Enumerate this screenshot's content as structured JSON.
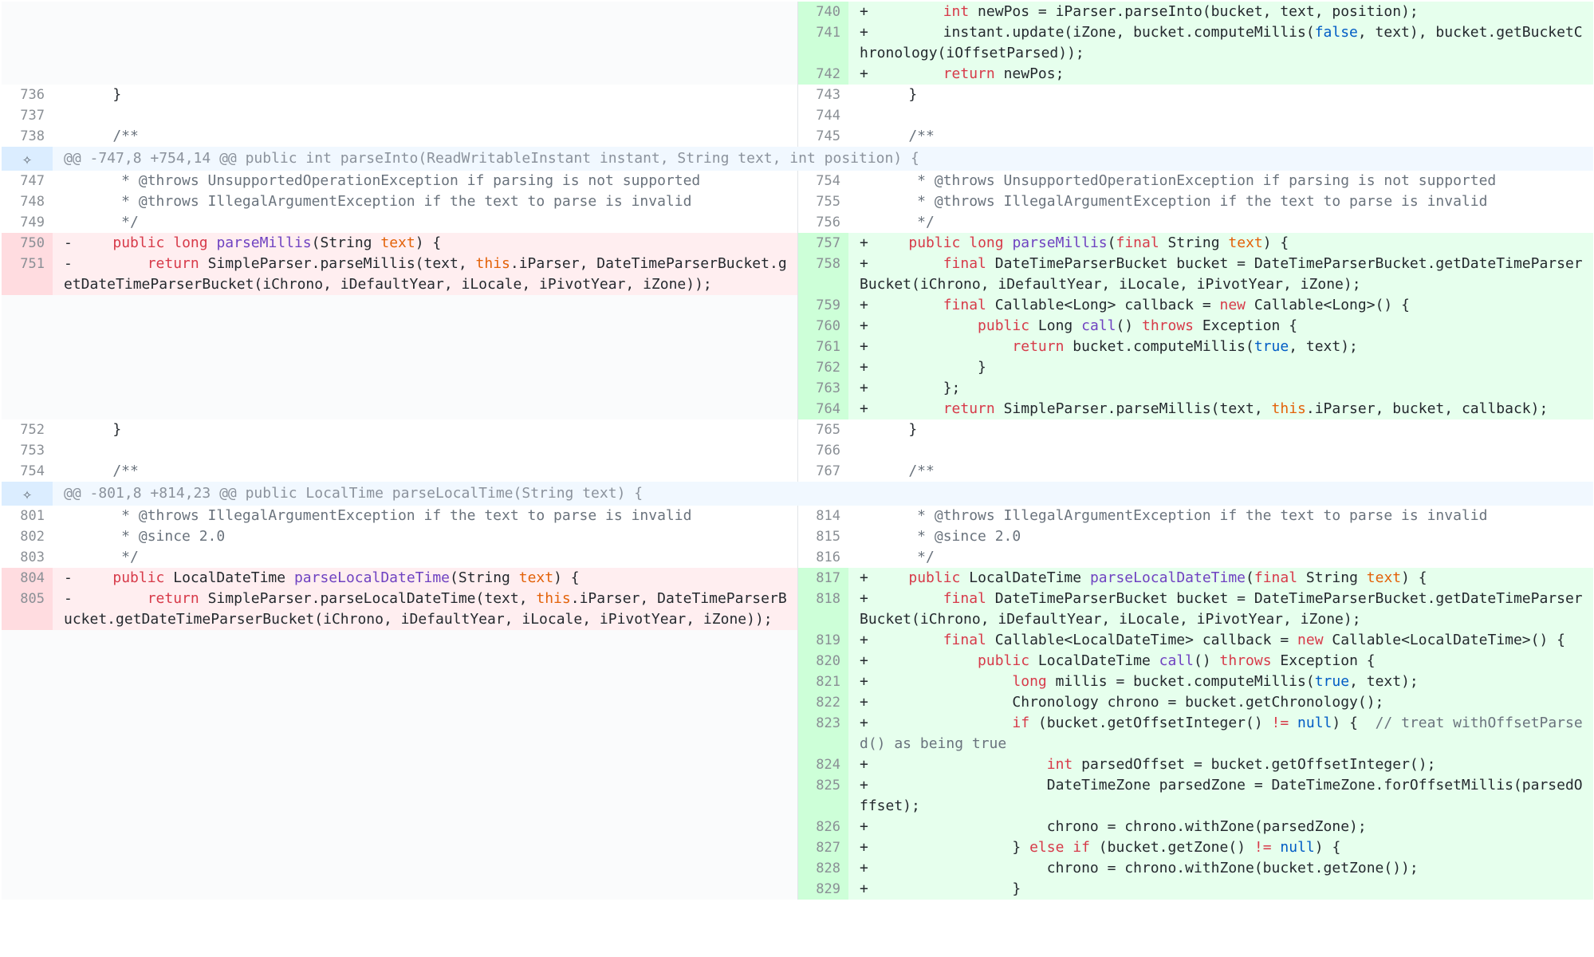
{
  "hunk_headers": [
    "@@ -747,8 +754,14 @@ public int parseInto(ReadWritableInstant instant, String text, int position) {",
    "@@ -801,8 +814,23 @@ public LocalTime parseLocalTime(String text) {"
  ],
  "expand_icon": "unfold-icon",
  "colors": {
    "deleted_line_bg": "#ffeef0",
    "added_line_bg": "#e6ffed",
    "deleted_gutter_bg": "#ffdce0",
    "added_gutter_bg": "#cdffd8",
    "hunk_bg": "#f1f8ff",
    "keyword": "#d73a49",
    "string_param": "#e36209",
    "method": "#6f42c1",
    "literal": "#005cc5",
    "comment": "#6a737d"
  },
  "rows": [
    {
      "type": "line",
      "l_num": "",
      "l_tok": [],
      "l_kind": "blank",
      "r_num": "740",
      "r_tok": [
        [
          "p",
          "+"
        ],
        [
          "t",
          "        "
        ],
        [
          "k",
          "int"
        ],
        [
          "t",
          " newPos = iParser.parseInto(bucket, text, position);"
        ]
      ],
      "r_kind": "add"
    },
    {
      "type": "line",
      "l_num": "",
      "l_tok": [],
      "l_kind": "blank",
      "r_num": "741",
      "r_tok": [
        [
          "p",
          "+"
        ],
        [
          "t",
          "        instant.update(iZone, bucket.computeMillis("
        ],
        [
          "b",
          "false"
        ],
        [
          "t",
          ", text), bucket.getBucketChronology(iOffsetParsed));"
        ]
      ],
      "r_kind": "add"
    },
    {
      "type": "line",
      "l_num": "",
      "l_tok": [],
      "l_kind": "blank",
      "r_num": "742",
      "r_tok": [
        [
          "p",
          "+"
        ],
        [
          "t",
          "        "
        ],
        [
          "k",
          "return"
        ],
        [
          "t",
          " newPos;"
        ]
      ],
      "r_kind": "add"
    },
    {
      "type": "line",
      "l_num": "736",
      "l_tok": [
        [
          "p",
          " "
        ],
        [
          "t",
          "    }"
        ]
      ],
      "l_kind": "ctx",
      "r_num": "743",
      "r_tok": [
        [
          "p",
          " "
        ],
        [
          "t",
          "    }"
        ]
      ],
      "r_kind": "ctx"
    },
    {
      "type": "line",
      "l_num": "737",
      "l_tok": [],
      "l_kind": "ctx",
      "r_num": "744",
      "r_tok": [],
      "r_kind": "ctx"
    },
    {
      "type": "line",
      "l_num": "738",
      "l_tok": [
        [
          "p",
          " "
        ],
        [
          "c",
          "    /**"
        ]
      ],
      "l_kind": "ctx",
      "r_num": "745",
      "r_tok": [
        [
          "p",
          " "
        ],
        [
          "c",
          "    /**"
        ]
      ],
      "r_kind": "ctx"
    },
    {
      "type": "hunk",
      "idx": 0
    },
    {
      "type": "line",
      "l_num": "747",
      "l_tok": [
        [
          "p",
          " "
        ],
        [
          "c",
          "     * @throws UnsupportedOperationException if parsing is not supported"
        ]
      ],
      "l_kind": "ctx",
      "r_num": "754",
      "r_tok": [
        [
          "p",
          " "
        ],
        [
          "c",
          "     * @throws UnsupportedOperationException if parsing is not supported"
        ]
      ],
      "r_kind": "ctx"
    },
    {
      "type": "line",
      "l_num": "748",
      "l_tok": [
        [
          "p",
          " "
        ],
        [
          "c",
          "     * @throws IllegalArgumentException if the text to parse is invalid"
        ]
      ],
      "l_kind": "ctx",
      "r_num": "755",
      "r_tok": [
        [
          "p",
          " "
        ],
        [
          "c",
          "     * @throws IllegalArgumentException if the text to parse is invalid"
        ]
      ],
      "r_kind": "ctx"
    },
    {
      "type": "line",
      "l_num": "749",
      "l_tok": [
        [
          "p",
          " "
        ],
        [
          "c",
          "     */"
        ]
      ],
      "l_kind": "ctx",
      "r_num": "756",
      "r_tok": [
        [
          "p",
          " "
        ],
        [
          "c",
          "     */"
        ]
      ],
      "r_kind": "ctx"
    },
    {
      "type": "line",
      "l_num": "750",
      "l_tok": [
        [
          "p",
          "-"
        ],
        [
          "t",
          "    "
        ],
        [
          "k",
          "public"
        ],
        [
          "t",
          " "
        ],
        [
          "k",
          "long"
        ],
        [
          "t",
          " "
        ],
        [
          "f",
          "parseMillis"
        ],
        [
          "t",
          "(String "
        ],
        [
          "s",
          "text"
        ],
        [
          "t",
          ") {"
        ]
      ],
      "l_kind": "del",
      "r_num": "757",
      "r_tok": [
        [
          "p",
          "+"
        ],
        [
          "t",
          "    "
        ],
        [
          "k",
          "public"
        ],
        [
          "t",
          " "
        ],
        [
          "k",
          "long"
        ],
        [
          "t",
          " "
        ],
        [
          "f",
          "parseMillis"
        ],
        [
          "t",
          "("
        ],
        [
          "k",
          "final"
        ],
        [
          "t",
          " String "
        ],
        [
          "s",
          "text"
        ],
        [
          "t",
          ") {"
        ]
      ],
      "r_kind": "add"
    },
    {
      "type": "line",
      "l_num": "751",
      "l_tok": [
        [
          "p",
          "-"
        ],
        [
          "t",
          "        "
        ],
        [
          "k",
          "return"
        ],
        [
          "t",
          " SimpleParser.parseMillis(text, "
        ],
        [
          "s",
          "this"
        ],
        [
          "t",
          ".iParser, DateTimeParserBucket.getDateTimeParserBucket(iChrono, iDefaultYear, iLocale, iPivotYear, iZone));"
        ]
      ],
      "l_kind": "del",
      "r_num": "758",
      "r_tok": [
        [
          "p",
          "+"
        ],
        [
          "t",
          "        "
        ],
        [
          "k",
          "final"
        ],
        [
          "t",
          " DateTimeParserBucket bucket = DateTimeParserBucket.getDateTimeParserBucket(iChrono, iDefaultYear, iLocale, iPivotYear, iZone);"
        ]
      ],
      "r_kind": "add"
    },
    {
      "type": "line",
      "l_num": "",
      "l_tok": [],
      "l_kind": "blank",
      "r_num": "759",
      "r_tok": [
        [
          "p",
          "+"
        ],
        [
          "t",
          "        "
        ],
        [
          "k",
          "final"
        ],
        [
          "t",
          " Callable<Long> callback = "
        ],
        [
          "k",
          "new"
        ],
        [
          "t",
          " Callable<Long>() {"
        ]
      ],
      "r_kind": "add"
    },
    {
      "type": "line",
      "l_num": "",
      "l_tok": [],
      "l_kind": "blank",
      "r_num": "760",
      "r_tok": [
        [
          "p",
          "+"
        ],
        [
          "t",
          "            "
        ],
        [
          "k",
          "public"
        ],
        [
          "t",
          " Long "
        ],
        [
          "f",
          "call"
        ],
        [
          "t",
          "() "
        ],
        [
          "k",
          "throws"
        ],
        [
          "t",
          " Exception {"
        ]
      ],
      "r_kind": "add"
    },
    {
      "type": "line",
      "l_num": "",
      "l_tok": [],
      "l_kind": "blank",
      "r_num": "761",
      "r_tok": [
        [
          "p",
          "+"
        ],
        [
          "t",
          "                "
        ],
        [
          "k",
          "return"
        ],
        [
          "t",
          " bucket.computeMillis("
        ],
        [
          "b",
          "true"
        ],
        [
          "t",
          ", text);"
        ]
      ],
      "r_kind": "add"
    },
    {
      "type": "line",
      "l_num": "",
      "l_tok": [],
      "l_kind": "blank",
      "r_num": "762",
      "r_tok": [
        [
          "p",
          "+"
        ],
        [
          "t",
          "            }"
        ]
      ],
      "r_kind": "add"
    },
    {
      "type": "line",
      "l_num": "",
      "l_tok": [],
      "l_kind": "blank",
      "r_num": "763",
      "r_tok": [
        [
          "p",
          "+"
        ],
        [
          "t",
          "        };"
        ]
      ],
      "r_kind": "add"
    },
    {
      "type": "line",
      "l_num": "",
      "l_tok": [],
      "l_kind": "blank",
      "r_num": "764",
      "r_tok": [
        [
          "p",
          "+"
        ],
        [
          "t",
          "        "
        ],
        [
          "k",
          "return"
        ],
        [
          "t",
          " SimpleParser.parseMillis(text, "
        ],
        [
          "s",
          "this"
        ],
        [
          "t",
          ".iParser, bucket, callback);"
        ]
      ],
      "r_kind": "add"
    },
    {
      "type": "line",
      "l_num": "752",
      "l_tok": [
        [
          "p",
          " "
        ],
        [
          "t",
          "    }"
        ]
      ],
      "l_kind": "ctx",
      "r_num": "765",
      "r_tok": [
        [
          "p",
          " "
        ],
        [
          "t",
          "    }"
        ]
      ],
      "r_kind": "ctx"
    },
    {
      "type": "line",
      "l_num": "753",
      "l_tok": [],
      "l_kind": "ctx",
      "r_num": "766",
      "r_tok": [],
      "r_kind": "ctx"
    },
    {
      "type": "line",
      "l_num": "754",
      "l_tok": [
        [
          "p",
          " "
        ],
        [
          "c",
          "    /**"
        ]
      ],
      "l_kind": "ctx",
      "r_num": "767",
      "r_tok": [
        [
          "p",
          " "
        ],
        [
          "c",
          "    /**"
        ]
      ],
      "r_kind": "ctx"
    },
    {
      "type": "hunk",
      "idx": 1
    },
    {
      "type": "line",
      "l_num": "801",
      "l_tok": [
        [
          "p",
          " "
        ],
        [
          "c",
          "     * @throws IllegalArgumentException if the text to parse is invalid"
        ]
      ],
      "l_kind": "ctx",
      "r_num": "814",
      "r_tok": [
        [
          "p",
          " "
        ],
        [
          "c",
          "     * @throws IllegalArgumentException if the text to parse is invalid"
        ]
      ],
      "r_kind": "ctx"
    },
    {
      "type": "line",
      "l_num": "802",
      "l_tok": [
        [
          "p",
          " "
        ],
        [
          "c",
          "     * @since 2.0"
        ]
      ],
      "l_kind": "ctx",
      "r_num": "815",
      "r_tok": [
        [
          "p",
          " "
        ],
        [
          "c",
          "     * @since 2.0"
        ]
      ],
      "r_kind": "ctx"
    },
    {
      "type": "line",
      "l_num": "803",
      "l_tok": [
        [
          "p",
          " "
        ],
        [
          "c",
          "     */"
        ]
      ],
      "l_kind": "ctx",
      "r_num": "816",
      "r_tok": [
        [
          "p",
          " "
        ],
        [
          "c",
          "     */"
        ]
      ],
      "r_kind": "ctx"
    },
    {
      "type": "line",
      "l_num": "804",
      "l_tok": [
        [
          "p",
          "-"
        ],
        [
          "t",
          "    "
        ],
        [
          "k",
          "public"
        ],
        [
          "t",
          " LocalDateTime "
        ],
        [
          "f",
          "parseLocalDateTime"
        ],
        [
          "t",
          "(String "
        ],
        [
          "s",
          "text"
        ],
        [
          "t",
          ") {"
        ]
      ],
      "l_kind": "del",
      "r_num": "817",
      "r_tok": [
        [
          "p",
          "+"
        ],
        [
          "t",
          "    "
        ],
        [
          "k",
          "public"
        ],
        [
          "t",
          " LocalDateTime "
        ],
        [
          "f",
          "parseLocalDateTime"
        ],
        [
          "t",
          "("
        ],
        [
          "k",
          "final"
        ],
        [
          "t",
          " String "
        ],
        [
          "s",
          "text"
        ],
        [
          "t",
          ") {"
        ]
      ],
      "r_kind": "add"
    },
    {
      "type": "line",
      "l_num": "805",
      "l_tok": [
        [
          "p",
          "-"
        ],
        [
          "t",
          "        "
        ],
        [
          "k",
          "return"
        ],
        [
          "t",
          " SimpleParser.parseLocalDateTime(text, "
        ],
        [
          "s",
          "this"
        ],
        [
          "t",
          ".iParser, DateTimeParserBucket.getDateTimeParserBucket(iChrono, iDefaultYear, iLocale, iPivotYear, iZone));"
        ]
      ],
      "l_kind": "del",
      "r_num": "818",
      "r_tok": [
        [
          "p",
          "+"
        ],
        [
          "t",
          "        "
        ],
        [
          "k",
          "final"
        ],
        [
          "t",
          " DateTimeParserBucket bucket = DateTimeParserBucket.getDateTimeParserBucket(iChrono, iDefaultYear, iLocale, iPivotYear, iZone);"
        ]
      ],
      "r_kind": "add"
    },
    {
      "type": "line",
      "l_num": "",
      "l_tok": [],
      "l_kind": "blank",
      "r_num": "819",
      "r_tok": [
        [
          "p",
          "+"
        ],
        [
          "t",
          "        "
        ],
        [
          "k",
          "final"
        ],
        [
          "t",
          " Callable<LocalDateTime> callback = "
        ],
        [
          "k",
          "new"
        ],
        [
          "t",
          " Callable<LocalDateTime>() {"
        ]
      ],
      "r_kind": "add"
    },
    {
      "type": "line",
      "l_num": "",
      "l_tok": [],
      "l_kind": "blank",
      "r_num": "820",
      "r_tok": [
        [
          "p",
          "+"
        ],
        [
          "t",
          "            "
        ],
        [
          "k",
          "public"
        ],
        [
          "t",
          " LocalDateTime "
        ],
        [
          "f",
          "call"
        ],
        [
          "t",
          "() "
        ],
        [
          "k",
          "throws"
        ],
        [
          "t",
          " Exception {"
        ]
      ],
      "r_kind": "add"
    },
    {
      "type": "line",
      "l_num": "",
      "l_tok": [],
      "l_kind": "blank",
      "r_num": "821",
      "r_tok": [
        [
          "p",
          "+"
        ],
        [
          "t",
          "                "
        ],
        [
          "k",
          "long"
        ],
        [
          "t",
          " millis = bucket.computeMillis("
        ],
        [
          "b",
          "true"
        ],
        [
          "t",
          ", text);"
        ]
      ],
      "r_kind": "add"
    },
    {
      "type": "line",
      "l_num": "",
      "l_tok": [],
      "l_kind": "blank",
      "r_num": "822",
      "r_tok": [
        [
          "p",
          "+"
        ],
        [
          "t",
          "                Chronology chrono = bucket.getChronology();"
        ]
      ],
      "r_kind": "add"
    },
    {
      "type": "line",
      "l_num": "",
      "l_tok": [],
      "l_kind": "blank",
      "r_num": "823",
      "r_tok": [
        [
          "p",
          "+"
        ],
        [
          "t",
          "                "
        ],
        [
          "k",
          "if"
        ],
        [
          "t",
          " (bucket.getOffsetInteger() "
        ],
        [
          "k",
          "!="
        ],
        [
          "t",
          " "
        ],
        [
          "b",
          "null"
        ],
        [
          "t",
          ") {  "
        ],
        [
          "c",
          "// treat withOffsetParsed() as being true"
        ]
      ],
      "r_kind": "add"
    },
    {
      "type": "line",
      "l_num": "",
      "l_tok": [],
      "l_kind": "blank",
      "r_num": "824",
      "r_tok": [
        [
          "p",
          "+"
        ],
        [
          "t",
          "                    "
        ],
        [
          "k",
          "int"
        ],
        [
          "t",
          " parsedOffset = bucket.getOffsetInteger();"
        ]
      ],
      "r_kind": "add"
    },
    {
      "type": "line",
      "l_num": "",
      "l_tok": [],
      "l_kind": "blank",
      "r_num": "825",
      "r_tok": [
        [
          "p",
          "+"
        ],
        [
          "t",
          "                    DateTimeZone parsedZone = DateTimeZone.forOffsetMillis(parsedOffset);"
        ]
      ],
      "r_kind": "add"
    },
    {
      "type": "line",
      "l_num": "",
      "l_tok": [],
      "l_kind": "blank",
      "r_num": "826",
      "r_tok": [
        [
          "p",
          "+"
        ],
        [
          "t",
          "                    chrono = chrono.withZone(parsedZone);"
        ]
      ],
      "r_kind": "add"
    },
    {
      "type": "line",
      "l_num": "",
      "l_tok": [],
      "l_kind": "blank",
      "r_num": "827",
      "r_tok": [
        [
          "p",
          "+"
        ],
        [
          "t",
          "                } "
        ],
        [
          "k",
          "else"
        ],
        [
          "t",
          " "
        ],
        [
          "k",
          "if"
        ],
        [
          "t",
          " (bucket.getZone() "
        ],
        [
          "k",
          "!="
        ],
        [
          "t",
          " "
        ],
        [
          "b",
          "null"
        ],
        [
          "t",
          ") {"
        ]
      ],
      "r_kind": "add"
    },
    {
      "type": "line",
      "l_num": "",
      "l_tok": [],
      "l_kind": "blank",
      "r_num": "828",
      "r_tok": [
        [
          "p",
          "+"
        ],
        [
          "t",
          "                    chrono = chrono.withZone(bucket.getZone());"
        ]
      ],
      "r_kind": "add"
    },
    {
      "type": "line",
      "l_num": "",
      "l_tok": [],
      "l_kind": "blank",
      "r_num": "829",
      "r_tok": [
        [
          "p",
          "+"
        ],
        [
          "t",
          "                }"
        ]
      ],
      "r_kind": "add"
    }
  ]
}
